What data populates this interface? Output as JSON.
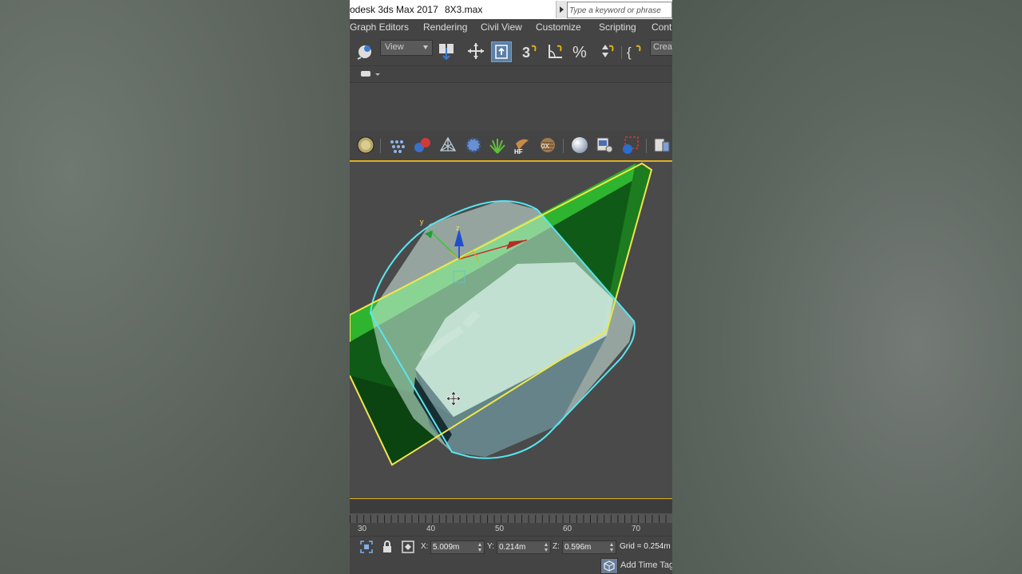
{
  "app": {
    "title": "odesk 3ds Max 2017",
    "file_name": "8X3.max",
    "search_placeholder": "Type a keyword or phrase"
  },
  "menu": {
    "items": [
      "Graph Editors",
      "Rendering",
      "Civil View",
      "Customize",
      "Scripting",
      "Cont"
    ]
  },
  "toolbar": {
    "view_select": "View",
    "create_select": "Crea"
  },
  "viewport": {
    "gizmo_y": "y",
    "gizmo_z": "z"
  },
  "timeline": {
    "ticks": [
      "30",
      "40",
      "50",
      "60",
      "70"
    ]
  },
  "status": {
    "x_label": "X:",
    "x_value": "5.009m",
    "y_label": "Y:",
    "y_value": "0.214m",
    "z_label": "Z:",
    "z_value": "0.596m",
    "grid": "Grid = 0.254m",
    "add_time_tag": "Add Time Tag"
  },
  "colors": {
    "selection_yellow": "#f2e64a",
    "selection_cyan": "#56e6f2",
    "box_green": "#1f8a1f",
    "cylinder": "#cfe9df",
    "timeline_accent": "#e0b020"
  }
}
